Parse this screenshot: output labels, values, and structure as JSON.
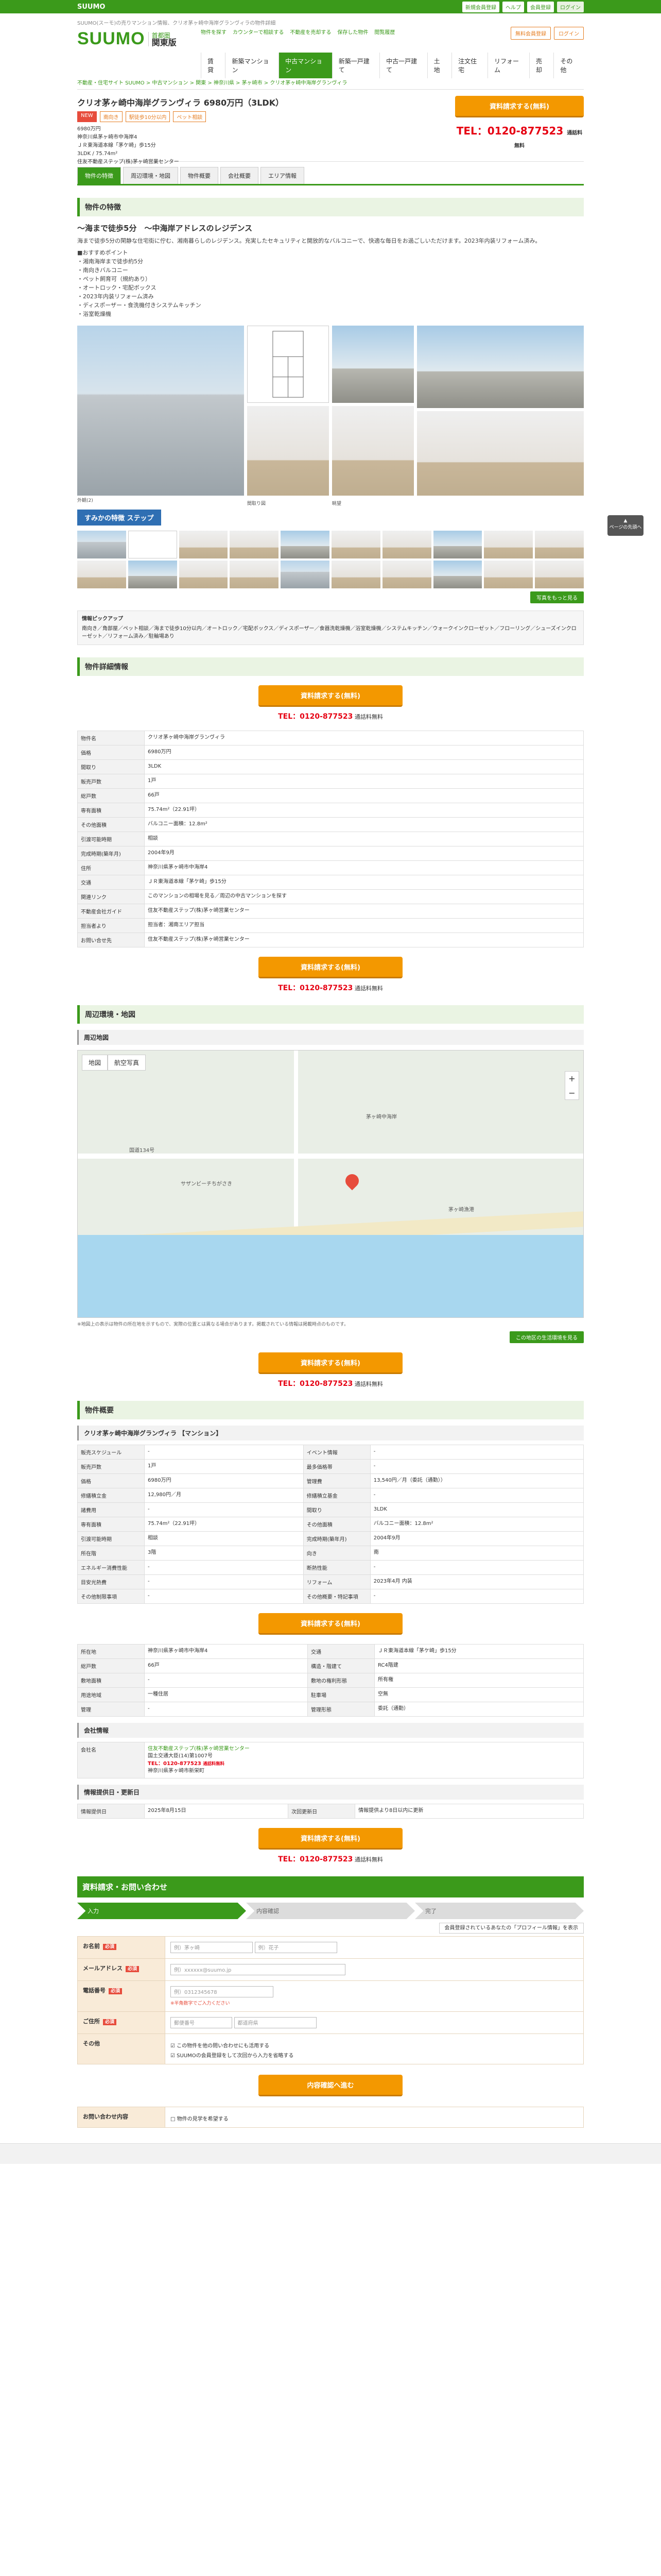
{
  "topbar": {
    "brand": "SUUMO",
    "links": [
      "新規会員登録",
      "ヘルプ",
      "会員登録",
      "ログイン"
    ]
  },
  "header": {
    "tagline": "SUUMO(スーモ)の売りマンション情報、クリオ茅ヶ崎中海岸グランヴィラの物件詳細",
    "brand": "SUUMO",
    "region_small": "首都圏",
    "region": "関東版",
    "links": [
      "物件を探す",
      "カウンターで相談する",
      "不動産を売却する",
      "保存した物件",
      "閲覧履歴",
      "無料会員登録",
      "ログイン"
    ],
    "cta": [
      "資料請求",
      "お気に入り"
    ],
    "nav": [
      "賃貸",
      "新築マンション",
      "中古マンション",
      "新築一戸建て",
      "中古一戸建て",
      "土地",
      "注文住宅",
      "リフォーム",
      "売却",
      "その他"
    ]
  },
  "breadcrumb": "不動産・住宅サイト SUUMO > 中古マンション > 関東 > 神奈川県 > 茅ヶ崎市 > クリオ茅ヶ崎中海岸グランヴィラ",
  "property": {
    "title": "クリオ茅ヶ崎中海岸グランヴィラ 6980万円（3LDK）",
    "tags": [
      "NEW",
      "南向き",
      "駅徒歩10分以内",
      "ペット相談"
    ],
    "price": "6980万円",
    "address": "神奈川県茅ヶ崎市中海岸4",
    "station": "ＪＲ東海道本線「茅ケ崎」歩15分",
    "layout": "3LDK / 75.74m²",
    "company": "住友不動産ステップ(株)茅ヶ崎営業センター",
    "cta_label": "資料請求する(無料)",
    "tel_label": "TEL：0120-877523",
    "tel_note": "通話料無料"
  },
  "tabs": [
    "物件の特徴",
    "周辺環境・地図",
    "物件概要",
    "会社概要",
    "エリア情報"
  ],
  "features": {
    "heading": "物件の特徴",
    "catch": "〜海まで徒歩5分　〜中海岸アドレスのレジデンス",
    "para": "海まで徒歩5分の閑静な住宅街に佇む、湘南暮らしのレジデンス。充実したセキュリティと開放的なバルコニーで、快適な毎日をお過ごしいただけます。2023年内装リフォーム済み。",
    "bullets": "■おすすめポイント\n・湘南海岸まで徒歩約5分\n・南向きバルコニー\n・ペット飼育可（規約あり）\n・オートロック・宅配ボックス\n・2023年内装リフォーム済み\n・ディスポーザー・食洗機付きシステムキッチン\n・浴室乾燥機",
    "photo_caption_1": "外観(2)",
    "photo_caption_2": "間取り図",
    "photo_caption_3": "眺望",
    "banner": "すみかの特徴 ステップ",
    "photo_link": "写真をもっと見る"
  },
  "pickup": {
    "title": "情報ピックアップ",
    "text": "南向き／角部屋／ペット相談／海まで徒歩10分以内／オートロック／宅配ボックス／ディスポーザー／食器洗乾燥機／浴室乾燥機／システムキッチン／ウォークインクローゼット／フローリング／シューズインクローゼット／リフォーム済み／駐輪場あり"
  },
  "detail": {
    "heading": "物件詳細情報",
    "rows": [
      {
        "k": "物件名",
        "v": "クリオ茅ヶ崎中海岸グランヴィラ"
      },
      {
        "k": "価格",
        "v": "6980万円"
      },
      {
        "k": "間取り",
        "v": "3LDK"
      },
      {
        "k": "販売戸数",
        "v": "1戸"
      },
      {
        "k": "総戸数",
        "v": "66戸"
      },
      {
        "k": "専有面積",
        "v": "75.74m²（22.91坪）"
      },
      {
        "k": "その他面積",
        "v": "バルコニー面積：12.8m²"
      },
      {
        "k": "引渡可能時期",
        "v": "相談"
      },
      {
        "k": "完成時期(築年月)",
        "v": "2004年9月"
      },
      {
        "k": "住所",
        "v": "神奈川県茅ヶ崎市中海岸4"
      },
      {
        "k": "交通",
        "v": "ＪＲ東海道本線「茅ケ崎」歩15分"
      },
      {
        "k": "関連リンク",
        "v": "このマンションの相場を見る／周辺の中古マンションを探す"
      },
      {
        "k": "不動産会社ガイド",
        "v": "住友不動産ステップ(株)茅ヶ崎営業センター"
      },
      {
        "k": "担当者より",
        "v": "担当者：湘南エリア担当"
      },
      {
        "k": "お問い合せ先",
        "v": "住友不動産ステップ(株)茅ヶ崎営業センター"
      }
    ],
    "tel": "TEL：0120-877523",
    "tel_note": "通話料無料"
  },
  "surroundings": {
    "heading": "周辺環境・地図",
    "map_label": "周辺地図",
    "map_tabs": [
      "地図",
      "航空写真"
    ],
    "map_labels": [
      "茅ヶ崎中海岸",
      "サザンビーチちがさき",
      "茅ヶ崎漁港",
      "国道134号"
    ],
    "map_note": "※地図上の表示は物件の所在地を示すもので、実際の位置とは異なる場合があります。掲載されている情報は掲載時点のものです。",
    "more": "この地区の生活環境を見る"
  },
  "overview": {
    "heading": "物件概要",
    "title": "クリオ茅ヶ崎中海岸グランヴィラ 【マンション】",
    "rows": [
      [
        "販売スケジュール",
        "-",
        "イベント情報",
        "-"
      ],
      [
        "販売戸数",
        "1戸",
        "最多価格帯",
        "-"
      ],
      [
        "価格",
        "6980万円",
        "管理費",
        "13,540円／月（委託（通勤））"
      ],
      [
        "修繕積立金",
        "12,980円／月",
        "修繕積立基金",
        "-"
      ],
      [
        "諸費用",
        "-",
        "間取り",
        "3LDK"
      ],
      [
        "専有面積",
        "75.74m²（22.91坪）",
        "その他面積",
        "バルコニー面積：12.8m²"
      ],
      [
        "引渡可能時期",
        "相談",
        "完成時期(築年月)",
        "2004年9月"
      ],
      [
        "所在階",
        "3階",
        "向き",
        "南"
      ],
      [
        "エネルギー消費性能",
        "-",
        "断熱性能",
        "-"
      ],
      [
        "目安光熱費",
        "-",
        "リフォーム",
        "2023年4月 内装"
      ],
      [
        "その他制限事項",
        "-",
        "その他概要・特記事項",
        "-"
      ]
    ],
    "building_rows": [
      [
        "所在地",
        "神奈川県茅ヶ崎市中海岸4",
        "交通",
        "ＪＲ東海道本線「茅ケ崎」歩15分"
      ],
      [
        "総戸数",
        "66戸",
        "構造・階建て",
        "RC4階建"
      ],
      [
        "敷地面積",
        "-",
        "敷地の権利形態",
        "所有権"
      ],
      [
        "用途地域",
        "一種住居",
        "駐車場",
        "空無"
      ],
      [
        "管理",
        "-",
        "管理形態",
        "委託（通勤）"
      ]
    ],
    "company": {
      "heading": "会社情報",
      "name": "住友不動産ステップ(株)茅ヶ崎営業センター",
      "license": "国土交通大臣(14)第1007号",
      "tel": "TEL：0120-877523",
      "tel_note": "通話料無料",
      "address": "神奈川県茅ヶ崎市新栄町"
    },
    "update": {
      "heading": "情報提供日・更新日",
      "provided_label": "情報提供日",
      "provided": "2025年8月15日",
      "next_label": "次回更新日",
      "next": "情報提供より8日以内に更新"
    }
  },
  "inquiry": {
    "heading": "資料請求・お問い合わせ",
    "steps": [
      "入力",
      "内容確認",
      "完了"
    ],
    "profile_link": "会員登録されているあなたの「プロフィール情報」を表示",
    "fields": [
      {
        "label": "お名前",
        "req": "必須",
        "ph1": "例）茅ヶ崎",
        "ph2": "例）花子"
      },
      {
        "label": "メールアドレス",
        "req": "必須",
        "ph1": "例）xxxxxx@suumo.jp"
      },
      {
        "label": "電話番号",
        "req": "必須",
        "ph1": "例）0312345678"
      },
      {
        "label": "ご住所",
        "req": "必須",
        "ph1": "郵便番号",
        "ph2": "都道府県"
      },
      {
        "label": "その他",
        "req": "",
        "ph1": "希望の連絡方法・時間帯など"
      },
      {
        "label": "お問い合わせ内容",
        "req": "",
        "ph1": "物件の見学を希望する"
      }
    ],
    "note": "※半角数字でご入力ください",
    "check1": "この物件を他の問い合わせにも活用する",
    "check2": "SUUMOの会員登録をして次回から入力を省略する",
    "submit": "内容確認へ進む"
  },
  "pagetop": "ページの先頭へ"
}
